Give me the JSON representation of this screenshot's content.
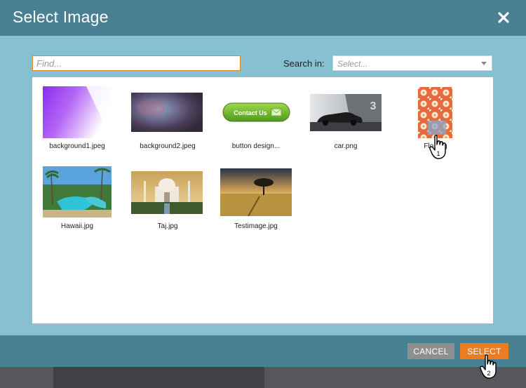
{
  "dialog": {
    "title": "Select Image",
    "close_icon": "close-icon"
  },
  "search": {
    "placeholder": "Find...",
    "search_in_label": "Search in:",
    "select_placeholder": "Select..."
  },
  "images": [
    {
      "name": "background1.jpeg"
    },
    {
      "name": "background2.jpeg"
    },
    {
      "name": "button design...",
      "button_text": "Contact Us"
    },
    {
      "name": "car.png",
      "badge": "3"
    },
    {
      "name": "Flo...ng"
    },
    {
      "name": "Hawaii.jpg"
    },
    {
      "name": "Taj.jpg"
    },
    {
      "name": "Testimage.jpg"
    }
  ],
  "footer": {
    "cancel_label": "CANCEL",
    "select_label": "SELECT"
  },
  "cursors": [
    {
      "step": "1"
    },
    {
      "step": "2"
    }
  ],
  "colors": {
    "title_bar": "#4a8094",
    "body": "#87c0d1",
    "select_button": "#ec7c22",
    "cancel_button": "#8e8f91"
  }
}
